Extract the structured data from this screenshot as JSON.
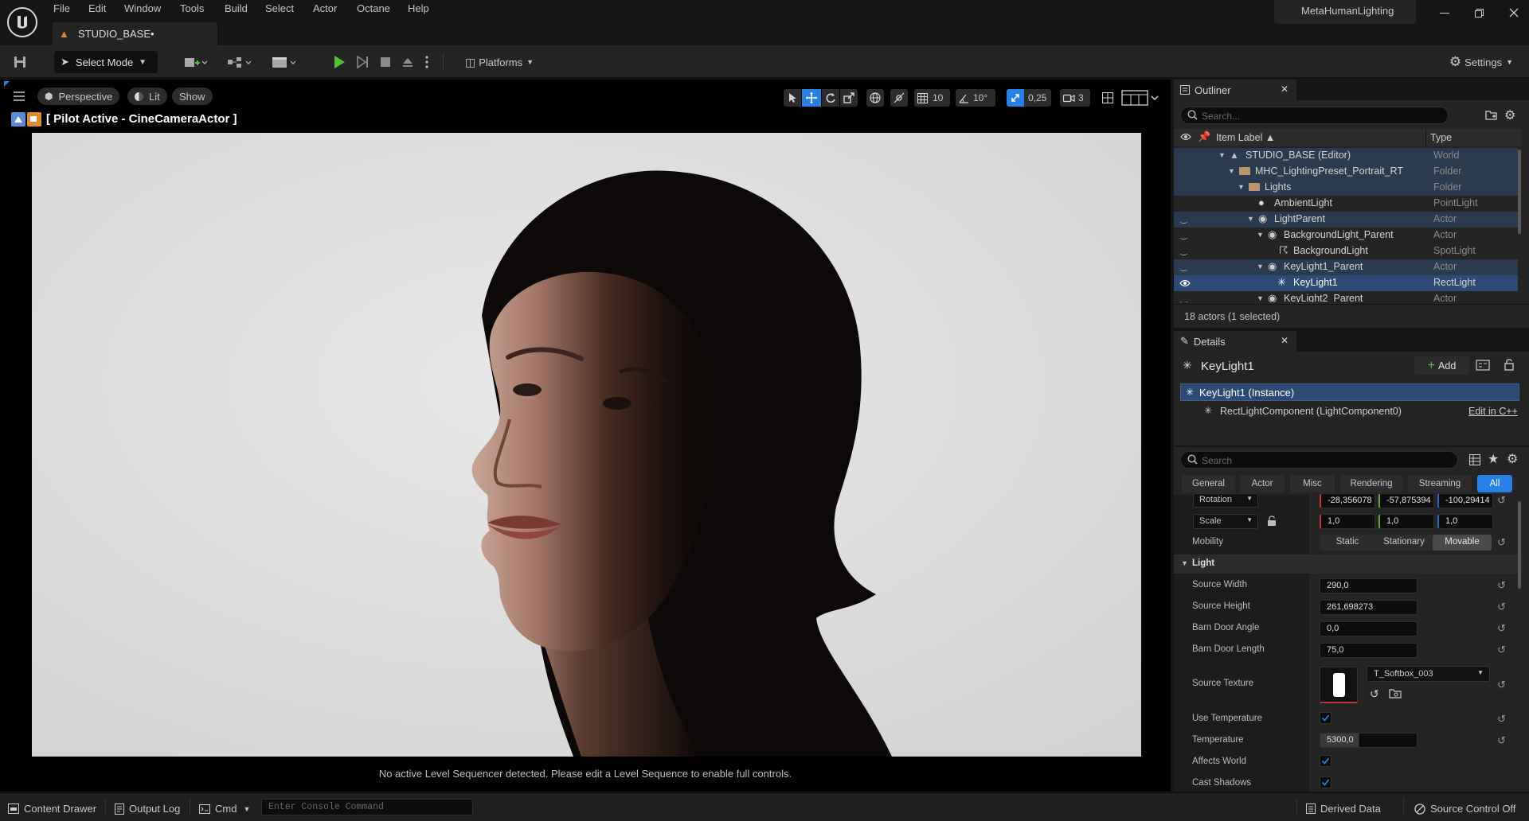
{
  "app": {
    "project_name": "MetaHumanLighting"
  },
  "menu": [
    "File",
    "Edit",
    "Window",
    "Tools",
    "Build",
    "Select",
    "Actor",
    "Octane",
    "Help"
  ],
  "level_tab": {
    "label": "STUDIO_BASE•"
  },
  "toolbar": {
    "select_mode": "Select Mode",
    "platforms": "Platforms",
    "settings": "Settings"
  },
  "viewport": {
    "perspective": "Perspective",
    "lit": "Lit",
    "show": "Show",
    "pilot_label": "[ Pilot Active - CineCameraActor ]",
    "grid_snap": "10",
    "rotation_snap": "10°",
    "scale_snap": "0,25",
    "camera_speed": "3",
    "sequencer_message": "No active Level Sequencer detected. Please edit a Level Sequence to enable full controls."
  },
  "outliner": {
    "tab_label": "Outliner",
    "search_placeholder": "Search...",
    "col_label": "Item Label ▲",
    "col_type": "Type",
    "rows": [
      {
        "label": "STUDIO_BASE (Editor)",
        "type": "World"
      },
      {
        "label": "MHC_LightingPreset_Portrait_RT",
        "type": "Folder"
      },
      {
        "label": "Lights",
        "type": "Folder"
      },
      {
        "label": "AmbientLight",
        "type": "PointLight"
      },
      {
        "label": "LightParent",
        "type": "Actor"
      },
      {
        "label": "BackgroundLight_Parent",
        "type": "Actor"
      },
      {
        "label": "BackgroundLight",
        "type": "SpotLight"
      },
      {
        "label": "KeyLight1_Parent",
        "type": "Actor"
      },
      {
        "label": "KeyLight1",
        "type": "RectLight"
      },
      {
        "label": "KeyLight2_Parent",
        "type": "Actor"
      }
    ],
    "footer": "18 actors (1 selected)"
  },
  "details": {
    "tab_label": "Details",
    "actor_name": "KeyLight1",
    "add_label": "Add",
    "instance_label": "KeyLight1 (Instance)",
    "component_label": "RectLightComponent (LightComponent0)",
    "edit_cpp": "Edit in C++",
    "search_placeholder": "Search",
    "categories": [
      "General",
      "Actor",
      "Misc",
      "Rendering",
      "Streaming",
      "All"
    ],
    "rotation": {
      "label": "Rotation",
      "x": "-28,356078",
      "y": "-57,875394",
      "z": "-100,29414"
    },
    "scale": {
      "label": "Scale",
      "x": "1,0",
      "y": "1,0",
      "z": "1,0"
    },
    "mobility": {
      "label": "Mobility",
      "options": [
        "Static",
        "Stationary",
        "Movable"
      ],
      "selected": "Movable"
    },
    "section_light": "Light",
    "source_width": {
      "label": "Source Width",
      "value": "290,0"
    },
    "source_height": {
      "label": "Source Height",
      "value": "261,698273"
    },
    "barn_door_angle": {
      "label": "Barn Door Angle",
      "value": "0,0"
    },
    "barn_door_length": {
      "label": "Barn Door Length",
      "value": "75,0"
    },
    "source_texture": {
      "label": "Source Texture",
      "value": "T_Softbox_003"
    },
    "use_temperature": {
      "label": "Use Temperature",
      "checked": true
    },
    "temperature": {
      "label": "Temperature",
      "value": "5300,0"
    },
    "affects_world": {
      "label": "Affects World",
      "checked": true
    },
    "cast_shadows": {
      "label": "Cast Shadows",
      "checked": true
    }
  },
  "statusbar": {
    "content_drawer": "Content Drawer",
    "output_log": "Output Log",
    "cmd": "Cmd",
    "console_placeholder": "Enter Console Command",
    "derived_data": "Derived Data",
    "source_control": "Source Control Off"
  },
  "colors": {
    "accent": "#2680e6",
    "selection": "#2c4a73",
    "play_green": "#55c23a"
  }
}
